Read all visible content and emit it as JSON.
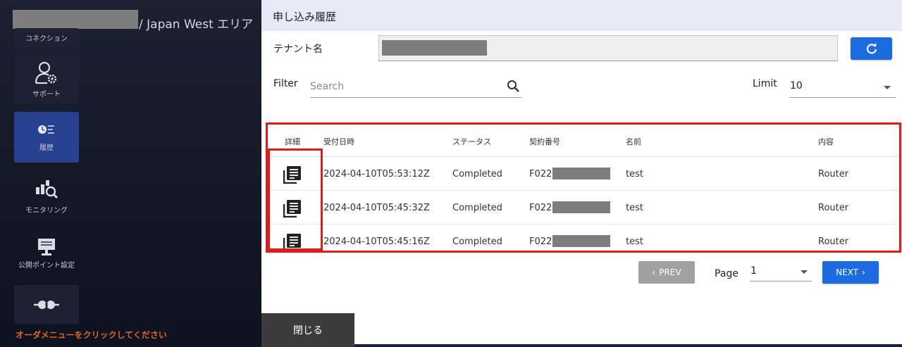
{
  "background": {
    "header_title": "/ Japan West エリア",
    "nav": [
      {
        "label": "コネクション",
        "icon": "connection-icon"
      },
      {
        "label": "サポート",
        "icon": "user-gear-icon"
      },
      {
        "label": "履歴",
        "icon": "history-icon"
      },
      {
        "label": "モニタリング",
        "icon": "monitoring-icon"
      },
      {
        "label": "公開ポイント設定",
        "icon": "monitor-stand-icon"
      },
      {
        "label": "",
        "icon": "plug-connect-icon"
      }
    ],
    "order_hint": "オーダメニューをクリックしてください"
  },
  "modal": {
    "title": "申し込み履歴",
    "tenant_label": "テナント名",
    "filter_label": "Filter",
    "search_placeholder": "Search",
    "search_value": "",
    "limit_label": "Limit",
    "limit_value": "10",
    "columns": {
      "detail": "詳細",
      "received": "受付日時",
      "status": "ステータス",
      "contract": "契約番号",
      "name": "名前",
      "content": "内容"
    },
    "rows": [
      {
        "received": "2024-04-10T05:53:12Z",
        "status": "Completed",
        "contract_prefix": "F022",
        "name": "test",
        "content": "Router"
      },
      {
        "received": "2024-04-10T05:45:32Z",
        "status": "Completed",
        "contract_prefix": "F022",
        "name": "test",
        "content": "Router"
      },
      {
        "received": "2024-04-10T05:45:16Z",
        "status": "Completed",
        "contract_prefix": "F022",
        "name": "test",
        "content": "Router"
      }
    ],
    "pagination": {
      "prev_label": "PREV",
      "page_label": "Page",
      "page_value": "1",
      "next_label": "NEXT"
    },
    "close_label": "閉じる"
  },
  "colors": {
    "primary": "#1d6be0",
    "highlight": "#e11b1b",
    "nav_active": "#27408f",
    "hint": "#e2661d"
  }
}
